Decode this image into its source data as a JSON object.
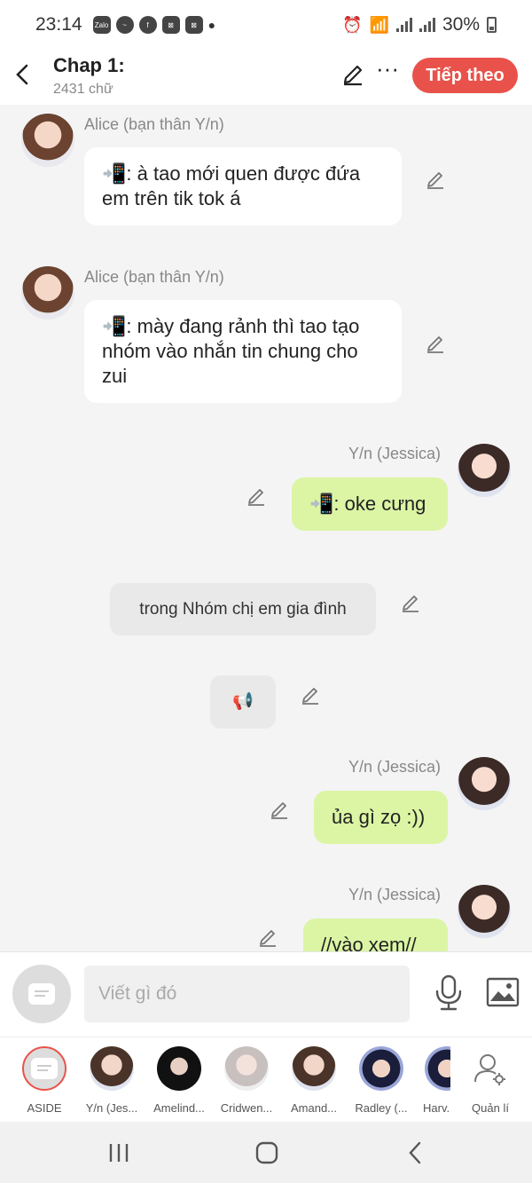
{
  "status_bar": {
    "time": "23:14",
    "battery": "30%",
    "app_icons": [
      "zalo-icon",
      "messenger-icon",
      "facebook-icon",
      "capcut-icon",
      "capcut-icon"
    ]
  },
  "header": {
    "title": "Chap 1:",
    "word_count": "2431 chữ",
    "next_label": "Tiếp theo"
  },
  "messages": [
    {
      "speaker": "Alice (bạn thân Y/n)",
      "text": "📲: à tao mới quen được đứa em trên tik tok á",
      "side": "left"
    },
    {
      "speaker": "Alice (bạn thân Y/n)",
      "text": "📲: mày đang rảnh thì tao tạo nhóm vào nhắn tin chung cho zui",
      "side": "left"
    },
    {
      "speaker": "Y/n (Jessica)",
      "text": "📲: oke cưng",
      "side": "right"
    },
    {
      "text": "trong Nhóm chị em gia đình",
      "side": "center"
    },
    {
      "text": "📢",
      "side": "center"
    },
    {
      "speaker": "Y/n (Jessica)",
      "text": "ủa gì zọ :))",
      "side": "right"
    },
    {
      "speaker": "Y/n (Jessica)",
      "text": "//vào xem//",
      "side": "right"
    }
  ],
  "composer": {
    "placeholder": "Viết gì đó"
  },
  "characters": [
    {
      "label": "ASIDE"
    },
    {
      "label": "Y/n (Jes..."
    },
    {
      "label": "Amelind..."
    },
    {
      "label": "Cridwen..."
    },
    {
      "label": "Amand..."
    },
    {
      "label": "Radley (..."
    },
    {
      "label": "Harv..."
    },
    {
      "label": "Quản lí"
    }
  ],
  "colors": {
    "accent": "#e9524a",
    "bubble_right": "#dbf5a4",
    "bubble_left": "#ffffff",
    "narration": "#e9e9e9",
    "background": "#f4f4f4"
  }
}
